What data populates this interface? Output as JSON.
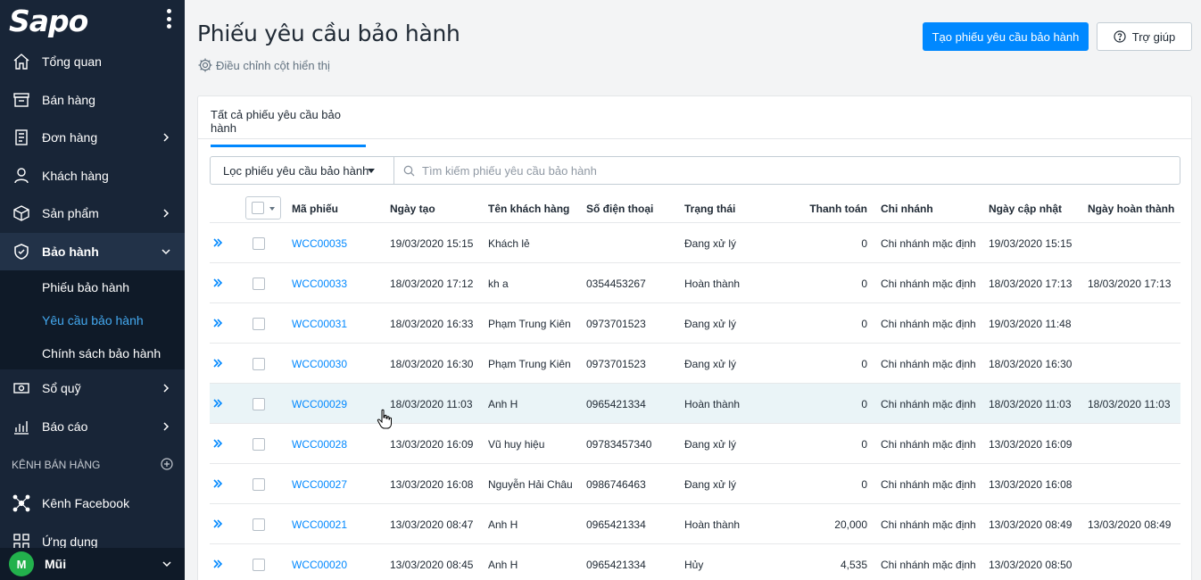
{
  "sidebar": {
    "logo": "Sapo",
    "items": [
      {
        "label": "Tổng quan",
        "icon": "home-icon"
      },
      {
        "label": "Bán hàng",
        "icon": "cart-icon"
      },
      {
        "label": "Đơn hàng",
        "icon": "order-icon"
      },
      {
        "label": "Khách hàng",
        "icon": "user-icon"
      },
      {
        "label": "Sản phẩm",
        "icon": "box-icon"
      },
      {
        "label": "Bảo hành",
        "icon": "shield-icon"
      },
      {
        "label": "Sổ quỹ",
        "icon": "cash-icon"
      },
      {
        "label": "Báo cáo",
        "icon": "report-icon"
      }
    ],
    "sub_items": [
      "Phiếu bảo hành",
      "Yêu cầu bảo hành",
      "Chính sách bảo hành"
    ],
    "section_title": "KÊNH BÁN HÀNG",
    "channels": [
      {
        "label": "Kênh Facebook",
        "icon": "network-icon"
      },
      {
        "label": "Ứng dụng",
        "icon": "apps-icon"
      }
    ],
    "user": {
      "initial": "M",
      "name": "Mũi"
    }
  },
  "header": {
    "title": "Phiếu yêu cầu bảo hành",
    "adjust_label": "Điều chỉnh cột hiển thị",
    "create_button": "Tạo phiếu yêu cầu bảo hành",
    "help_button": "Trợ giúp"
  },
  "tabs": [
    "Tất cả phiếu yêu cầu bảo hành"
  ],
  "filter": {
    "button_label": "Lọc phiếu yêu cầu bảo hành",
    "search_placeholder": "Tìm kiếm phiếu yêu cầu bảo hành"
  },
  "table": {
    "columns": [
      "Mã phiếu",
      "Ngày tạo",
      "Tên khách hàng",
      "Số điện thoại",
      "Trạng thái",
      "Thanh toán",
      "Chi nhánh",
      "Ngày cập nhật",
      "Ngày hoàn thành"
    ],
    "rows": [
      [
        "WCC00035",
        "19/03/2020 15:15",
        "Khách lẻ",
        "",
        "Đang xử lý",
        "0",
        "Chi nhánh mặc định",
        "19/03/2020 15:15",
        ""
      ],
      [
        "WCC00033",
        "18/03/2020 17:12",
        "kh a",
        "0354453267",
        "Hoàn thành",
        "0",
        "Chi nhánh mặc định",
        "18/03/2020 17:13",
        "18/03/2020 17:13"
      ],
      [
        "WCC00031",
        "18/03/2020 16:33",
        "Phạm Trung Kiên",
        "0973701523",
        "Đang xử lý",
        "0",
        "Chi nhánh mặc định",
        "19/03/2020 11:48",
        ""
      ],
      [
        "WCC00030",
        "18/03/2020 16:30",
        "Phạm Trung Kiên",
        "0973701523",
        "Đang xử lý",
        "0",
        "Chi nhánh mặc định",
        "18/03/2020 16:30",
        ""
      ],
      [
        "WCC00029",
        "18/03/2020 11:03",
        "Anh H",
        "0965421334",
        "Hoàn thành",
        "0",
        "Chi nhánh mặc định",
        "18/03/2020 11:03",
        "18/03/2020 11:03"
      ],
      [
        "WCC00028",
        "13/03/2020 16:09",
        "Vũ huy hiệu",
        "09783457340",
        "Đang xử lý",
        "0",
        "Chi nhánh mặc định",
        "13/03/2020 16:09",
        ""
      ],
      [
        "WCC00027",
        "13/03/2020 16:08",
        "Nguyễn Hải Châu",
        "0986746463",
        "Đang xử lý",
        "0",
        "Chi nhánh mặc định",
        "13/03/2020 16:08",
        ""
      ],
      [
        "WCC00021",
        "13/03/2020 08:47",
        "Anh H",
        "0965421334",
        "Hoàn thành",
        "20,000",
        "Chi nhánh mặc định",
        "13/03/2020 08:49",
        "13/03/2020 08:49"
      ],
      [
        "WCC00020",
        "13/03/2020 08:45",
        "Anh H",
        "0965421334",
        "Hủy",
        "4,535",
        "Chi nhánh mặc định",
        "13/03/2020 08:50",
        ""
      ]
    ]
  },
  "colors": {
    "sidebar_bg": "#182537",
    "primary": "#0088ff",
    "active_sub": "#44a9f0",
    "row_hover": "#eaf4f7"
  }
}
